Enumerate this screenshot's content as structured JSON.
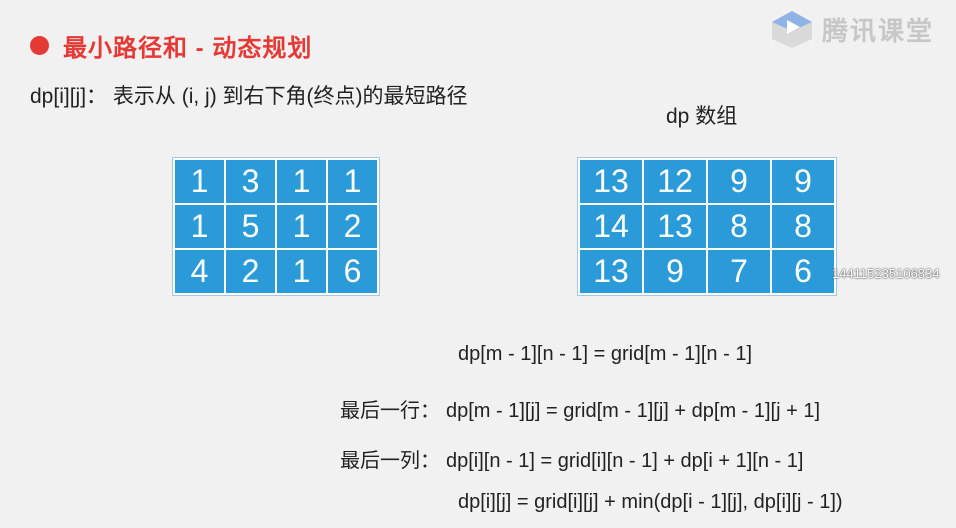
{
  "header": {
    "title": "最小路径和 - 动态规划",
    "logo_text": "腾讯课堂"
  },
  "definition": "dp[i][j]： 表示从 (i, j) 到右下角(终点)的最短路径",
  "dp_label": "dp 数组",
  "grid": [
    [
      "1",
      "3",
      "1",
      "1"
    ],
    [
      "1",
      "5",
      "1",
      "2"
    ],
    [
      "4",
      "2",
      "1",
      "6"
    ]
  ],
  "dp": [
    [
      "13",
      "12",
      "9",
      "9"
    ],
    [
      "14",
      "13",
      "8",
      "8"
    ],
    [
      "13",
      "9",
      "7",
      "6"
    ]
  ],
  "side_number": "144115235106834",
  "formulas": {
    "base": "dp[m - 1][n - 1] = grid[m - 1][n - 1]",
    "last_row_label": "最后一行：",
    "last_row": "dp[m - 1][j] = grid[m - 1][j] + dp[m - 1][j + 1]",
    "last_col_label": "最后一列：",
    "last_col": "dp[i][n - 1] = grid[i][n - 1] + dp[i + 1][n - 1]",
    "general": "dp[i][j] = grid[i][j] + min(dp[i - 1][j], dp[i][j - 1])"
  },
  "colors": {
    "title": "#e53935",
    "cell": "#2a9ad8",
    "logo": "#c7c7c7"
  }
}
